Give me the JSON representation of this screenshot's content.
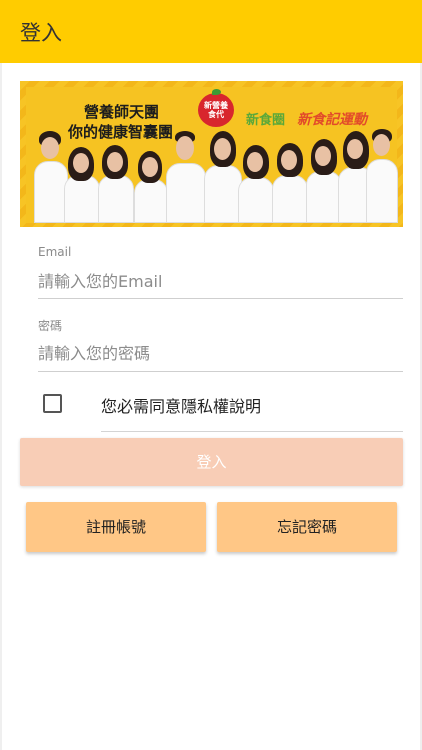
{
  "appbar": {
    "title": "登入"
  },
  "banner": {
    "headline_line1": "營養師天團",
    "headline_line2": "你的健康智囊團",
    "apple_logo_text": "新營養\n食代",
    "logo_mid_text": "新食圈",
    "logo_right_text": "新食記運動"
  },
  "form": {
    "email_label": "Email",
    "email_placeholder": "請輸入您的Email",
    "password_label": "密碼",
    "password_placeholder": "請輸入您的密碼",
    "privacy_text": "您必需同意隱私權說明",
    "privacy_checked": false
  },
  "buttons": {
    "login": "登入",
    "register": "註冊帳號",
    "forgot": "忘記密碼"
  },
  "colors": {
    "appbar": "#FFCC00",
    "login_disabled": "#F8CDB6",
    "secondary": "#FFC786"
  }
}
